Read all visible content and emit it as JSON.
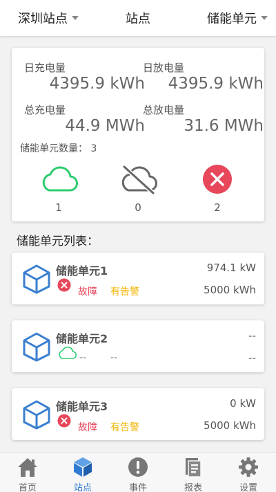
{
  "header": {
    "site_selector": "深圳站点",
    "title": "站点",
    "unit_selector": "储能单元"
  },
  "summary": {
    "daily_charge_label": "日充电量",
    "daily_charge_value": "4395.9 kWh",
    "daily_discharge_label": "日放电量",
    "daily_discharge_value": "4395.9 kWh",
    "total_charge_label": "总充电量",
    "total_charge_value": "44.9 MWh",
    "total_discharge_label": "总放电量",
    "total_discharge_value": "31.6 MWh",
    "unit_count_label": "储能单元数量：",
    "unit_count_value": "3",
    "status_online_count": "1",
    "status_offline_count": "0",
    "status_fault_count": "2"
  },
  "list_title": "储能单元列表：",
  "units": [
    {
      "name": "储能单元1",
      "power": "974.1 kW",
      "energy": "5000 kWh",
      "state": "故障",
      "alarm": "有告警"
    },
    {
      "name": "储能单元2",
      "power": "--",
      "energy": "--",
      "state": "--",
      "alarm": "--"
    },
    {
      "name": "储能单元3",
      "power": "0 kW",
      "energy": "5000 kWh",
      "state": "故障",
      "alarm": "有告警"
    }
  ],
  "nav": [
    {
      "label": "首页",
      "icon": "home-icon"
    },
    {
      "label": "站点",
      "icon": "cube-icon"
    },
    {
      "label": "事件",
      "icon": "alert-icon"
    },
    {
      "label": "报表",
      "icon": "report-icon"
    },
    {
      "label": "设置",
      "icon": "gear-icon"
    }
  ],
  "colors": {
    "online": "#2ecc71",
    "fault": "#e8465a",
    "alarm": "#f0b400",
    "accent": "#2f7bd1",
    "cube": "#3a7fd0"
  }
}
